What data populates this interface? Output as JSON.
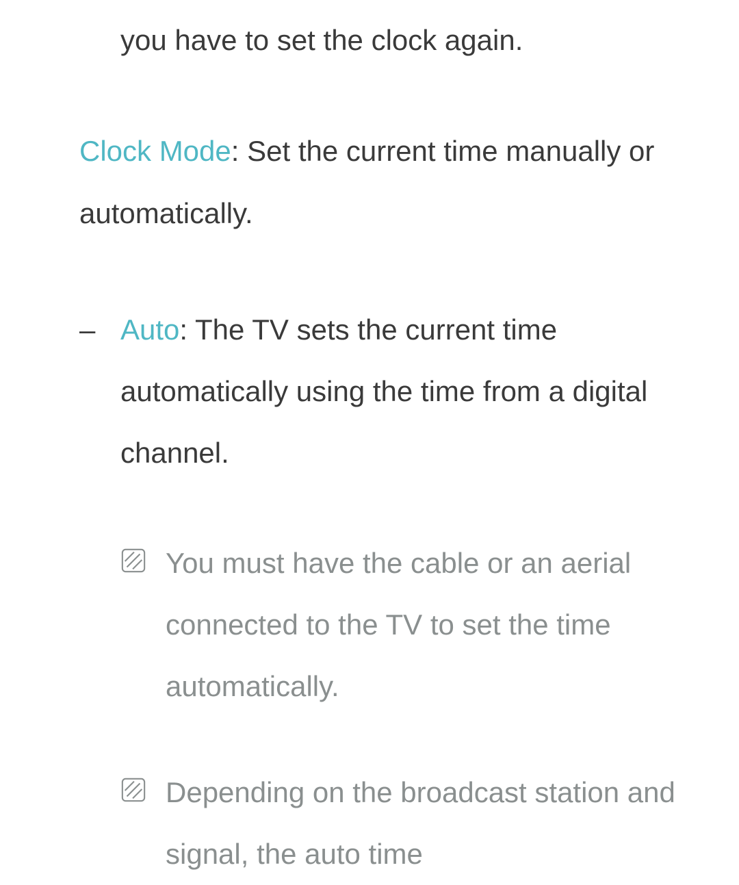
{
  "top_line": "you have to set the clock again.",
  "clock_mode": {
    "term": "Clock Mode",
    "desc": ": Set the current time manually or automatically."
  },
  "auto": {
    "dash": "–",
    "term": "Auto",
    "desc": ": The TV sets the current time automatically using the time from a digital channel."
  },
  "notes": [
    {
      "text": "You must have the cable or an aerial connected to the TV to set the time automatically."
    },
    {
      "text": "Depending on the broadcast station and signal, the auto time"
    }
  ]
}
